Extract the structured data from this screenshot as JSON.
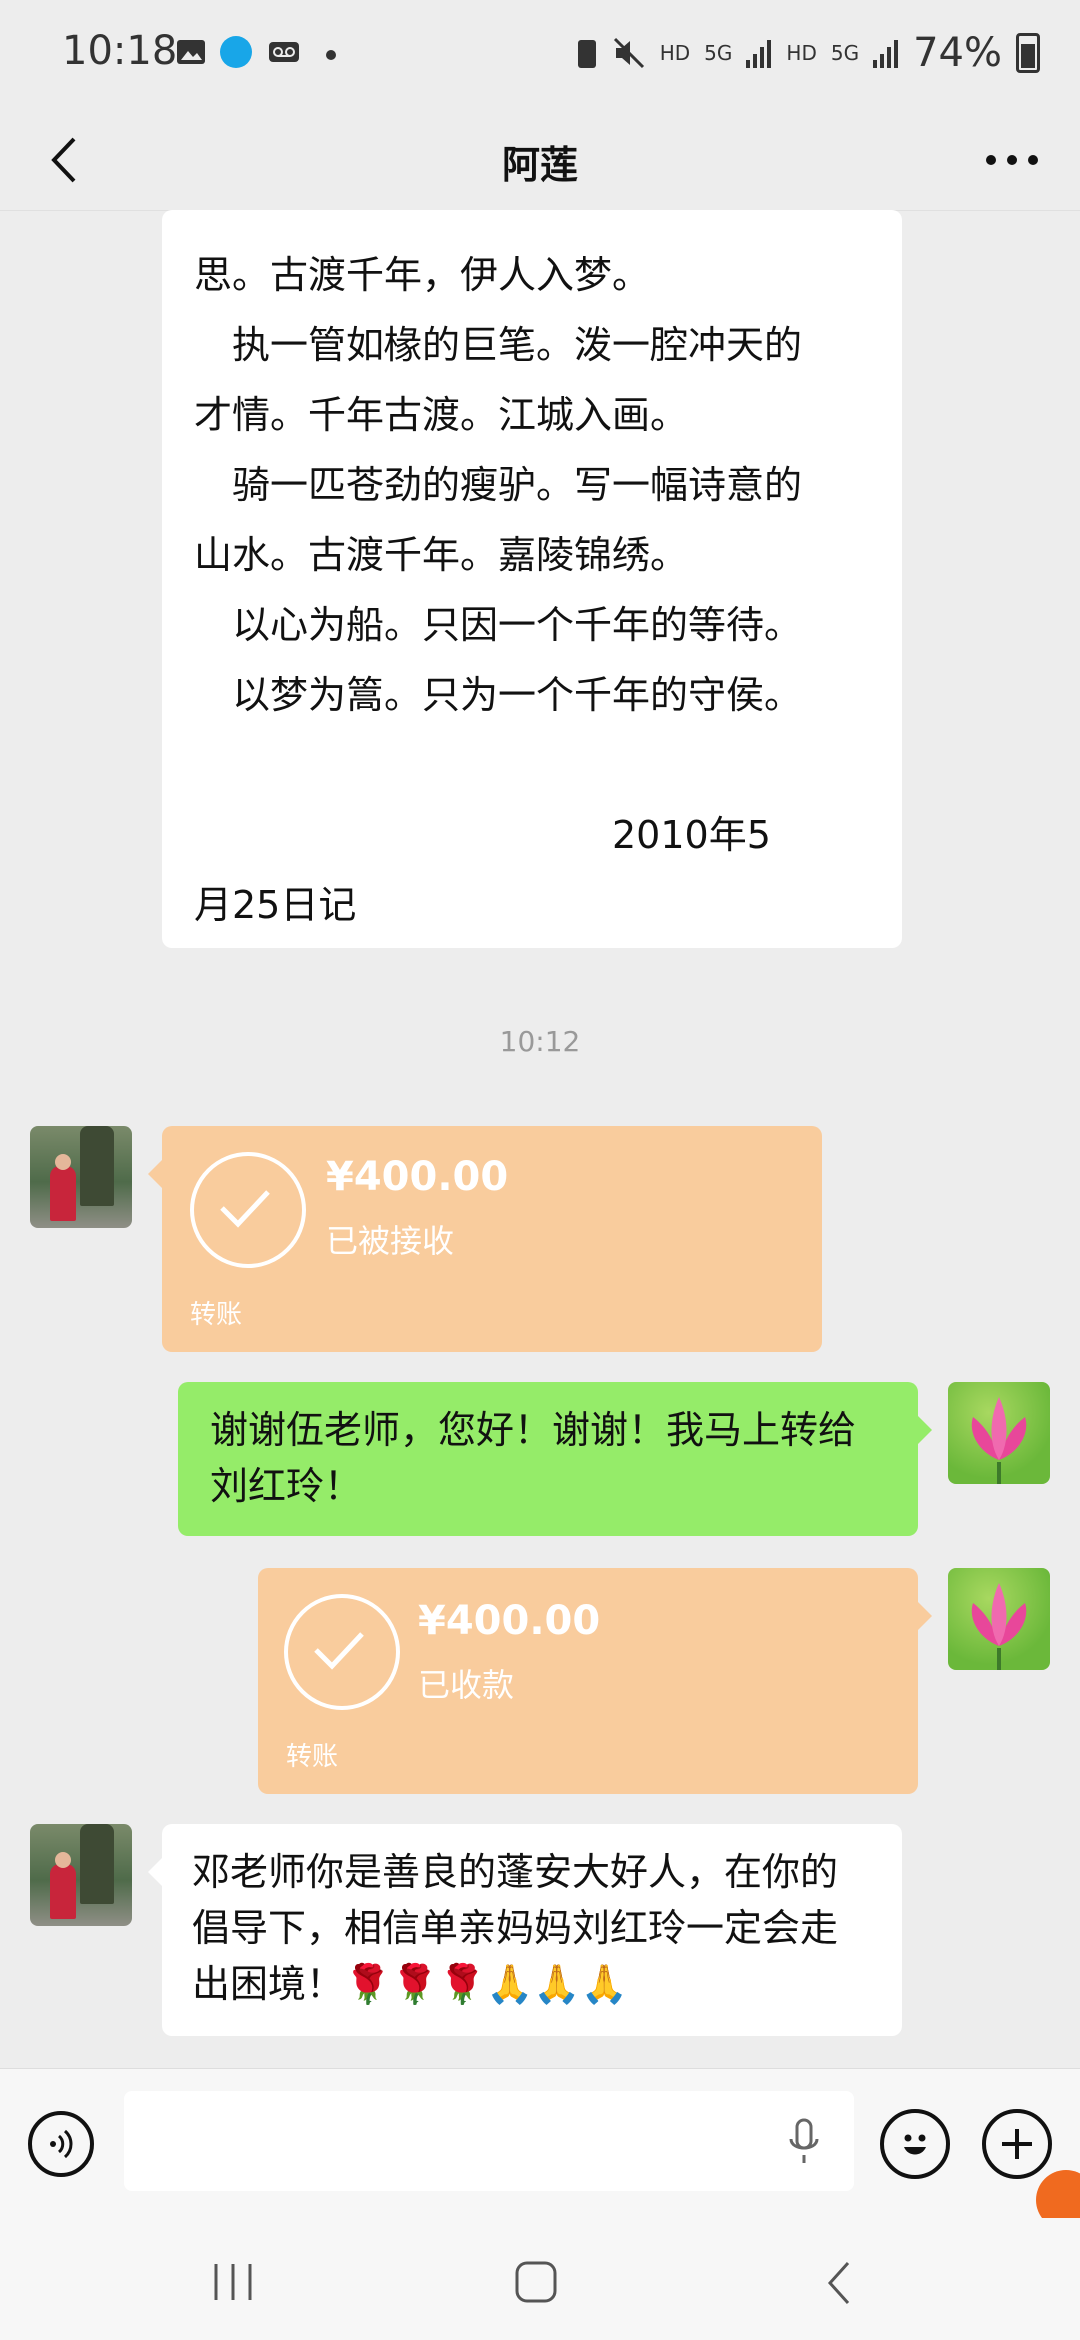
{
  "status_bar": {
    "time": "10:18",
    "network_1": "HD",
    "network_2": "5G",
    "network_3": "HD",
    "network_4": "5G",
    "battery": "74%"
  },
  "header": {
    "title": "阿莲"
  },
  "poem": {
    "lines": [
      "思。古渡千年，伊人入梦。",
      "　执一管如椽的巨笔。泼一腔冲天的",
      "才情。千年古渡。江城入画。",
      "　骑一匹苍劲的瘦驴。写一幅诗意的",
      "山水。古渡千年。嘉陵锦绣。",
      "　以心为船。只因一个千年的等待。",
      "　以梦为篙。只为一个千年的守侯。",
      "",
      "　　　　　　　　　　　2010年5",
      "月25日记"
    ]
  },
  "timestamp": "10:12",
  "messages": {
    "transfer1": {
      "amount": "¥400.00",
      "status": "已被接收",
      "label": "转账"
    },
    "reply1": {
      "text": "谢谢伍老师，您好！谢谢！我马上转给刘红玲！"
    },
    "transfer2": {
      "amount": "¥400.00",
      "status": "已收款",
      "label": "转账"
    },
    "incoming2": {
      "text": "邓老师你是善良的蓬安大好人，在你的倡导下，相信单亲妈妈刘红玲一定会走出困境！🌹🌹🌹🙏🙏🙏"
    }
  },
  "input": {
    "placeholder": ""
  },
  "colors": {
    "background": "#ededed",
    "sent_bubble": "#95ec69",
    "transfer_bubble": "#f9cc9d"
  }
}
